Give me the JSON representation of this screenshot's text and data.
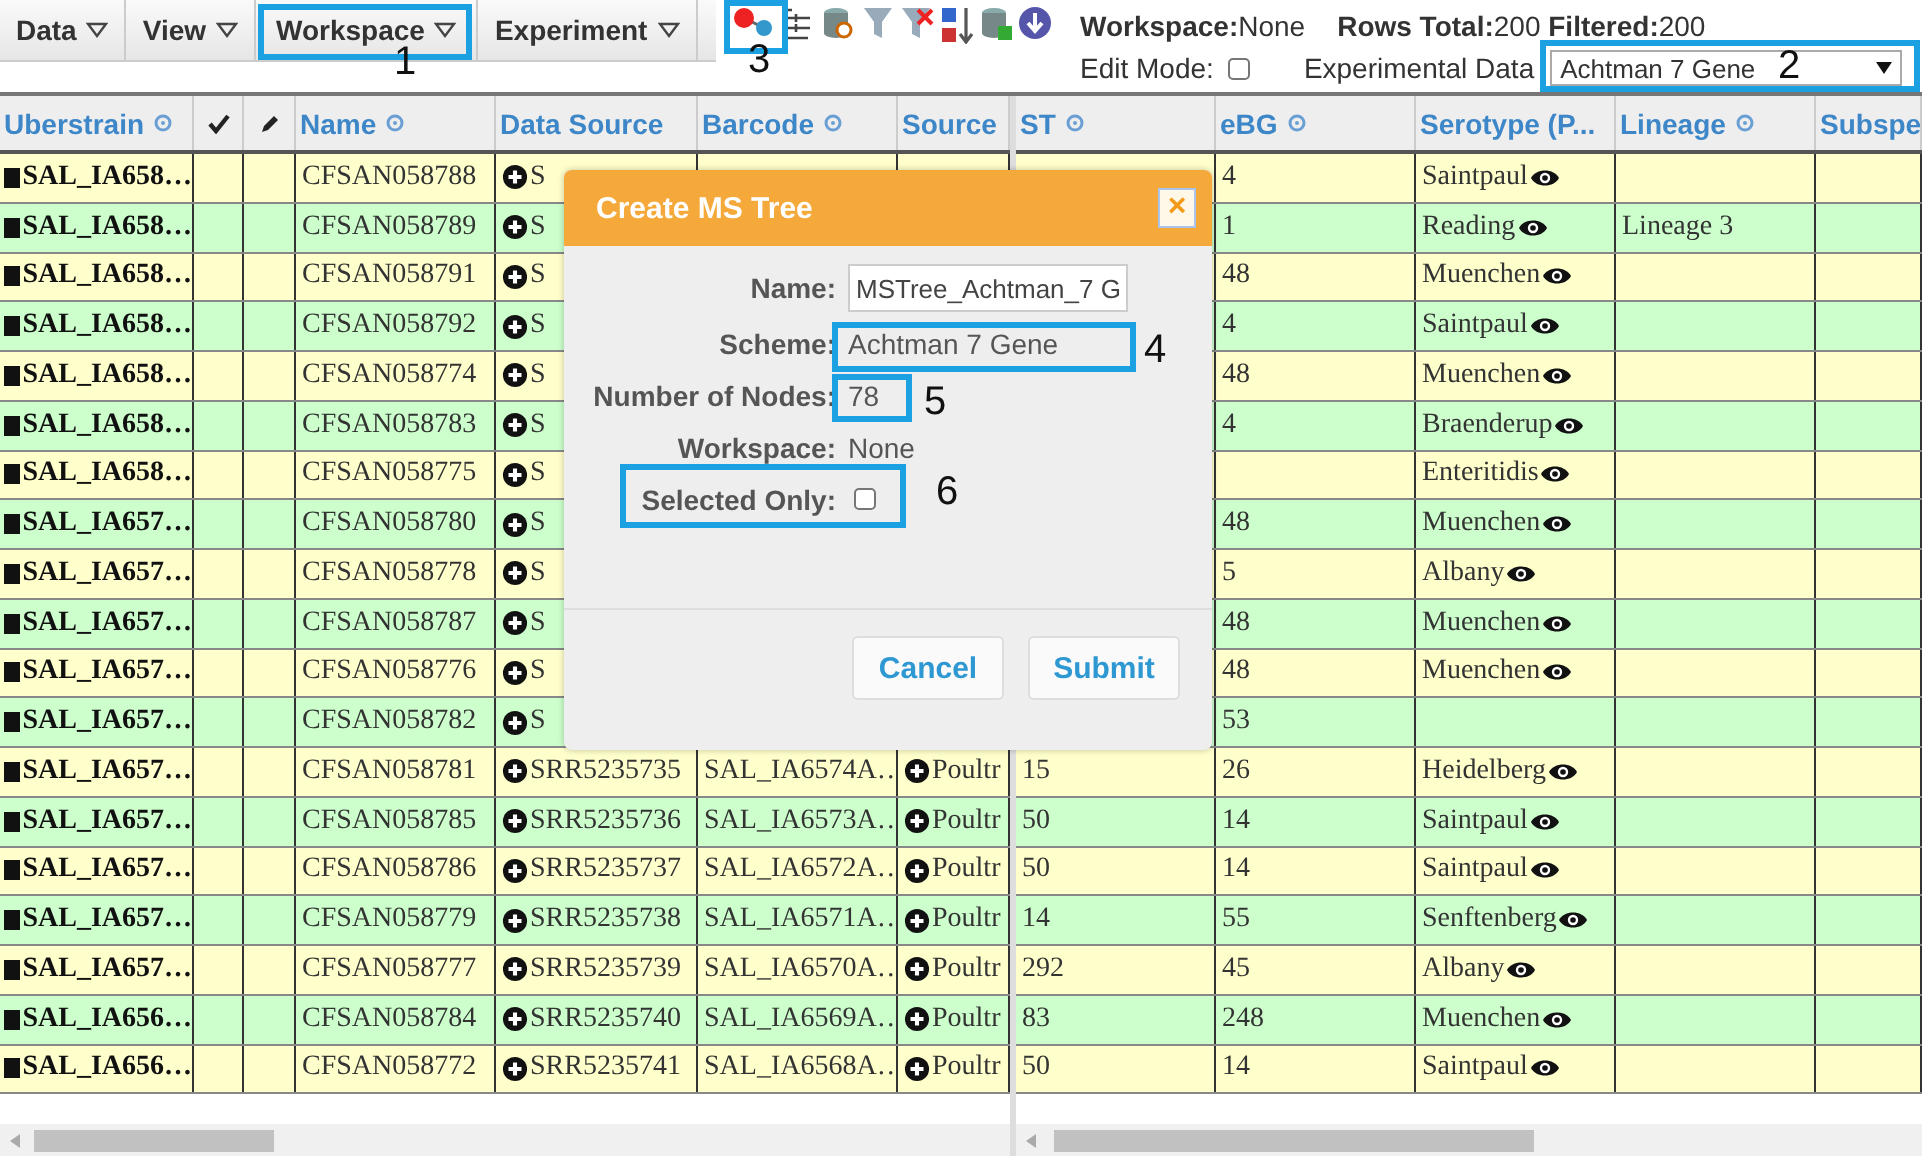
{
  "menu": [
    {
      "label": "Data"
    },
    {
      "label": "View"
    },
    {
      "label": "Workspace"
    },
    {
      "label": "Experiment"
    }
  ],
  "toolbar": {
    "workspace": "**Workspace:**None",
    "counts": "**Rows Total:**200 **Filtered:**200",
    "edit_mode": {
      "label": "Edit Mode:",
      "checked": false
    },
    "experimental_data": {
      "label": "Experimental Data",
      "value": "Achtman 7 Gene"
    }
  },
  "table": {
    "left_columns": [
      {
        "kind": "text",
        "label": "Uberstrain",
        "info": true
      },
      {
        "kind": "check"
      },
      {
        "kind": "edit"
      },
      {
        "kind": "text",
        "label": "Name",
        "info": true
      },
      {
        "kind": "text",
        "label": "Data Source",
        "info": false
      },
      {
        "kind": "text",
        "label": "Barcode",
        "info": true
      },
      {
        "kind": "text",
        "label": "Source"
      }
    ],
    "right_columns": [
      {
        "kind": "text",
        "label": "ST",
        "info": true
      },
      {
        "kind": "text",
        "label": "eBG",
        "info": true
      },
      {
        "kind": "text",
        "label": "Serotype (P...",
        "info": false
      },
      {
        "kind": "text",
        "label": "Lineage",
        "info": true
      },
      {
        "kind": "text",
        "label": "Subspe"
      }
    ],
    "rows": [
      {
        "uberstrain": "SAL_IA658…",
        "name": "CFSAN058788",
        "data_source": "S",
        "barcode": "",
        "source": "",
        "st": "",
        "ebg": "4",
        "serotype": "Saintpaul",
        "lineage": ""
      },
      {
        "uberstrain": "SAL_IA658…",
        "name": "CFSAN058789",
        "data_source": "S",
        "barcode": "",
        "source": "",
        "st": "",
        "ebg": "1",
        "serotype": "Reading",
        "lineage": "Lineage 3"
      },
      {
        "uberstrain": "SAL_IA658…",
        "name": "CFSAN058791",
        "data_source": "S",
        "barcode": "",
        "source": "",
        "st": "",
        "ebg": "48",
        "serotype": "Muenchen",
        "lineage": ""
      },
      {
        "uberstrain": "SAL_IA658…",
        "name": "CFSAN058792",
        "data_source": "S",
        "barcode": "",
        "source": "",
        "st": "",
        "ebg": "4",
        "serotype": "Saintpaul",
        "lineage": ""
      },
      {
        "uberstrain": "SAL_IA658…",
        "name": "CFSAN058774",
        "data_source": "S",
        "barcode": "",
        "source": "",
        "st": "",
        "ebg": "48",
        "serotype": "Muenchen",
        "lineage": ""
      },
      {
        "uberstrain": "SAL_IA658…",
        "name": "CFSAN058783",
        "data_source": "S",
        "barcode": "",
        "source": "",
        "st": "",
        "ebg": "4",
        "serotype": "Braenderup",
        "lineage": ""
      },
      {
        "uberstrain": "SAL_IA658…",
        "name": "CFSAN058775",
        "data_source": "S",
        "barcode": "",
        "source": "",
        "st": "",
        "ebg": "",
        "serotype": "Enteritidis",
        "lineage": ""
      },
      {
        "uberstrain": "SAL_IA657…",
        "name": "CFSAN058780",
        "data_source": "S",
        "barcode": "",
        "source": "",
        "st": "",
        "ebg": "48",
        "serotype": "Muenchen",
        "lineage": ""
      },
      {
        "uberstrain": "SAL_IA657…",
        "name": "CFSAN058778",
        "data_source": "S",
        "barcode": "",
        "source": "",
        "st": "",
        "ebg": "5",
        "serotype": "Albany",
        "lineage": ""
      },
      {
        "uberstrain": "SAL_IA657…",
        "name": "CFSAN058787",
        "data_source": "S",
        "barcode": "",
        "source": "",
        "st": "",
        "ebg": "48",
        "serotype": "Muenchen",
        "lineage": ""
      },
      {
        "uberstrain": "SAL_IA657…",
        "name": "CFSAN058776",
        "data_source": "S",
        "barcode": "",
        "source": "",
        "st": "",
        "ebg": "48",
        "serotype": "Muenchen",
        "lineage": ""
      },
      {
        "uberstrain": "SAL_IA657…",
        "name": "CFSAN058782",
        "data_source": "S",
        "barcode": "",
        "source": "",
        "st": "",
        "ebg": "53",
        "serotype": "",
        "lineage": ""
      },
      {
        "uberstrain": "SAL_IA657…",
        "name": "CFSAN058781",
        "data_source": "SRR5235735",
        "barcode": "SAL_IA6574A…",
        "source": "Poultr",
        "st": "15",
        "ebg": "26",
        "serotype": "Heidelberg",
        "lineage": ""
      },
      {
        "uberstrain": "SAL_IA657…",
        "name": "CFSAN058785",
        "data_source": "SRR5235736",
        "barcode": "SAL_IA6573A…",
        "source": "Poultr",
        "st": "50",
        "ebg": "14",
        "serotype": "Saintpaul",
        "lineage": ""
      },
      {
        "uberstrain": "SAL_IA657…",
        "name": "CFSAN058786",
        "data_source": "SRR5235737",
        "barcode": "SAL_IA6572A…",
        "source": "Poultr",
        "st": "50",
        "ebg": "14",
        "serotype": "Saintpaul",
        "lineage": ""
      },
      {
        "uberstrain": "SAL_IA657…",
        "name": "CFSAN058779",
        "data_source": "SRR5235738",
        "barcode": "SAL_IA6571A…",
        "source": "Poultr",
        "st": "14",
        "ebg": "55",
        "serotype": "Senftenberg",
        "lineage": ""
      },
      {
        "uberstrain": "SAL_IA657…",
        "name": "CFSAN058777",
        "data_source": "SRR5235739",
        "barcode": "SAL_IA6570A…",
        "source": "Poultr",
        "st": "292",
        "ebg": "45",
        "serotype": "Albany",
        "lineage": ""
      },
      {
        "uberstrain": "SAL_IA656…",
        "name": "CFSAN058784",
        "data_source": "SRR5235740",
        "barcode": "SAL_IA6569A…",
        "source": "Poultr",
        "st": "83",
        "ebg": "248",
        "serotype": "Muenchen",
        "lineage": ""
      },
      {
        "uberstrain": "SAL_IA656…",
        "name": "CFSAN058772",
        "data_source": "SRR5235741",
        "barcode": "SAL_IA6568A…",
        "source": "Poultr",
        "st": "50",
        "ebg": "14",
        "serotype": "Saintpaul",
        "lineage": ""
      }
    ]
  },
  "dialog": {
    "title": "Create MS Tree",
    "close": "×",
    "name": {
      "label": "Name:",
      "value": "MSTree_Achtman_7 G"
    },
    "scheme": {
      "label": "Scheme:",
      "value": "Achtman 7 Gene"
    },
    "nodes": {
      "label": "Number of Nodes:",
      "value": "78"
    },
    "workspace": {
      "label": "Workspace:",
      "value": "None"
    },
    "selected_only": {
      "label": "Selected Only:",
      "checked": false
    },
    "buttons": [
      "Cancel",
      "Submit"
    ]
  },
  "callouts": [
    {
      "number": "1"
    },
    {
      "number": "3"
    },
    {
      "number": "2"
    },
    {
      "number": "4"
    },
    {
      "number": "5"
    },
    {
      "number": "6"
    }
  ]
}
